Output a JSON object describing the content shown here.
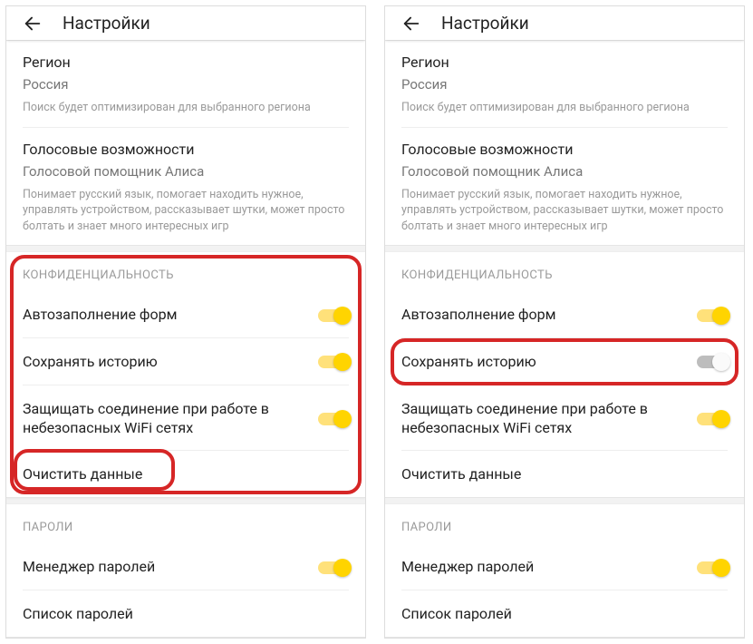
{
  "header": {
    "title": "Настройки"
  },
  "region": {
    "label": "Регион",
    "value": "Россия",
    "hint": "Поиск будет оптимизирован для выбранного региона"
  },
  "voice": {
    "label": "Голосовые возможности",
    "value": "Голосовой помощник Алиса",
    "hint": "Понимает русский язык, помогает находить нужное, управлять устройством, рассказывает шутки, может просто болтать и знает много интересных игр"
  },
  "privacy": {
    "header": "КОНФИДЕНЦИАЛЬНОСТЬ",
    "autofill": "Автозаполнение форм",
    "history": "Сохранять историю",
    "wifi": "Защищать соединение при работе в небезопасных WiFi сетях",
    "clear": "Очистить данные"
  },
  "passwords": {
    "header": "ПАРОЛИ",
    "manager": "Менеджер паролей",
    "list": "Список паролей"
  }
}
